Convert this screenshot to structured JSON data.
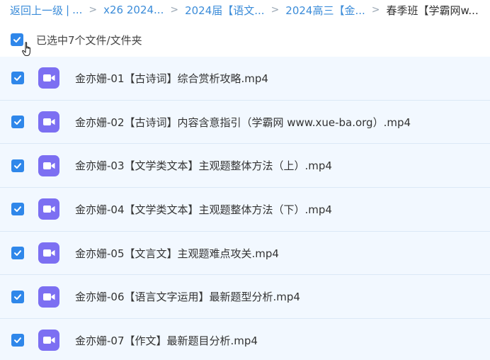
{
  "breadcrumb": {
    "back_label": "返回上一级",
    "divider": "|",
    "ellipsis": "...",
    "items": [
      "x26 2024...",
      "2024届【语文...",
      "2024高三【金..."
    ],
    "separator": ">",
    "current": "春季班【学霸网w..."
  },
  "selection": {
    "label": "已选中7个文件/文件夹"
  },
  "icons": {
    "checkbox": "checkbox-checked-icon",
    "file": "video-file-icon",
    "cursor": "hand-pointer-icon"
  },
  "colors": {
    "accent": "#2f87ea",
    "link": "#3b8cd9",
    "row_bg": "#f2f8ff",
    "video_icon": "#7c6ff2"
  },
  "files": [
    {
      "name": "金亦姗-01【古诗词】综合赏析攻略.mp4",
      "checked": true
    },
    {
      "name": "金亦姗-02【古诗词】内容含意指引（学霸网 www.xue-ba.org）.mp4",
      "checked": true
    },
    {
      "name": "金亦姗-03【文学类文本】主观题整体方法（上）.mp4",
      "checked": true
    },
    {
      "name": "金亦姗-04【文学类文本】主观题整体方法（下）.mp4",
      "checked": true
    },
    {
      "name": "金亦姗-05【文言文】主观题难点攻关.mp4",
      "checked": true
    },
    {
      "name": "金亦姗-06【语言文字运用】最新题型分析.mp4",
      "checked": true
    },
    {
      "name": "金亦姗-07【作文】最新题目分析.mp4",
      "checked": true
    }
  ]
}
